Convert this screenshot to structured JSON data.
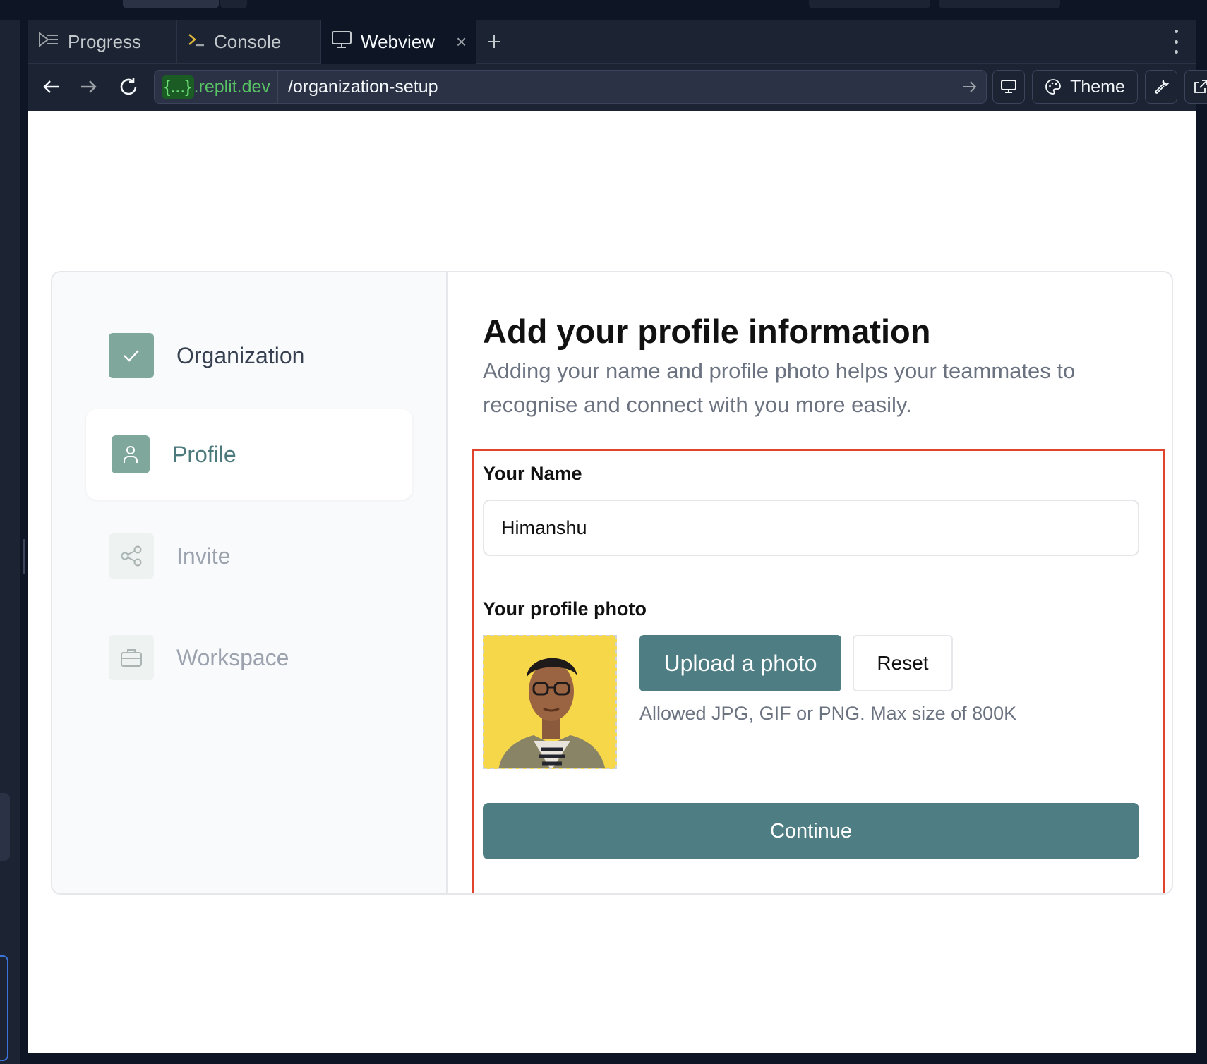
{
  "tabs": [
    {
      "label": "Progress",
      "icon": "progress-icon"
    },
    {
      "label": "Console",
      "icon": "terminal-icon"
    },
    {
      "label": "Webview",
      "icon": "monitor-icon",
      "active": true
    }
  ],
  "address": {
    "domain_prefix": "{...}",
    "domain_suffix": ".replit.dev",
    "path": "/organization-setup"
  },
  "toolbar": {
    "theme_label": "Theme"
  },
  "steps": [
    {
      "label": "Organization",
      "state": "done",
      "icon": "check-icon"
    },
    {
      "label": "Profile",
      "state": "current",
      "icon": "user-icon"
    },
    {
      "label": "Invite",
      "state": "todo",
      "icon": "share-icon"
    },
    {
      "label": "Workspace",
      "state": "todo",
      "icon": "briefcase-icon"
    }
  ],
  "form": {
    "title": "Add your profile information",
    "subtitle": "Adding your name and profile photo helps your teammates to recognise and connect with you more easily.",
    "name_label": "Your Name",
    "name_value": "Himanshu",
    "photo_label": "Your profile photo",
    "upload_label": "Upload a photo",
    "reset_label": "Reset",
    "hint": "Allowed JPG, GIF or PNG. Max size of 800K",
    "continue_label": "Continue"
  },
  "colors": {
    "accent": "#4e7d83",
    "highlight": "#e0442c",
    "url_domain": "#58c364"
  }
}
